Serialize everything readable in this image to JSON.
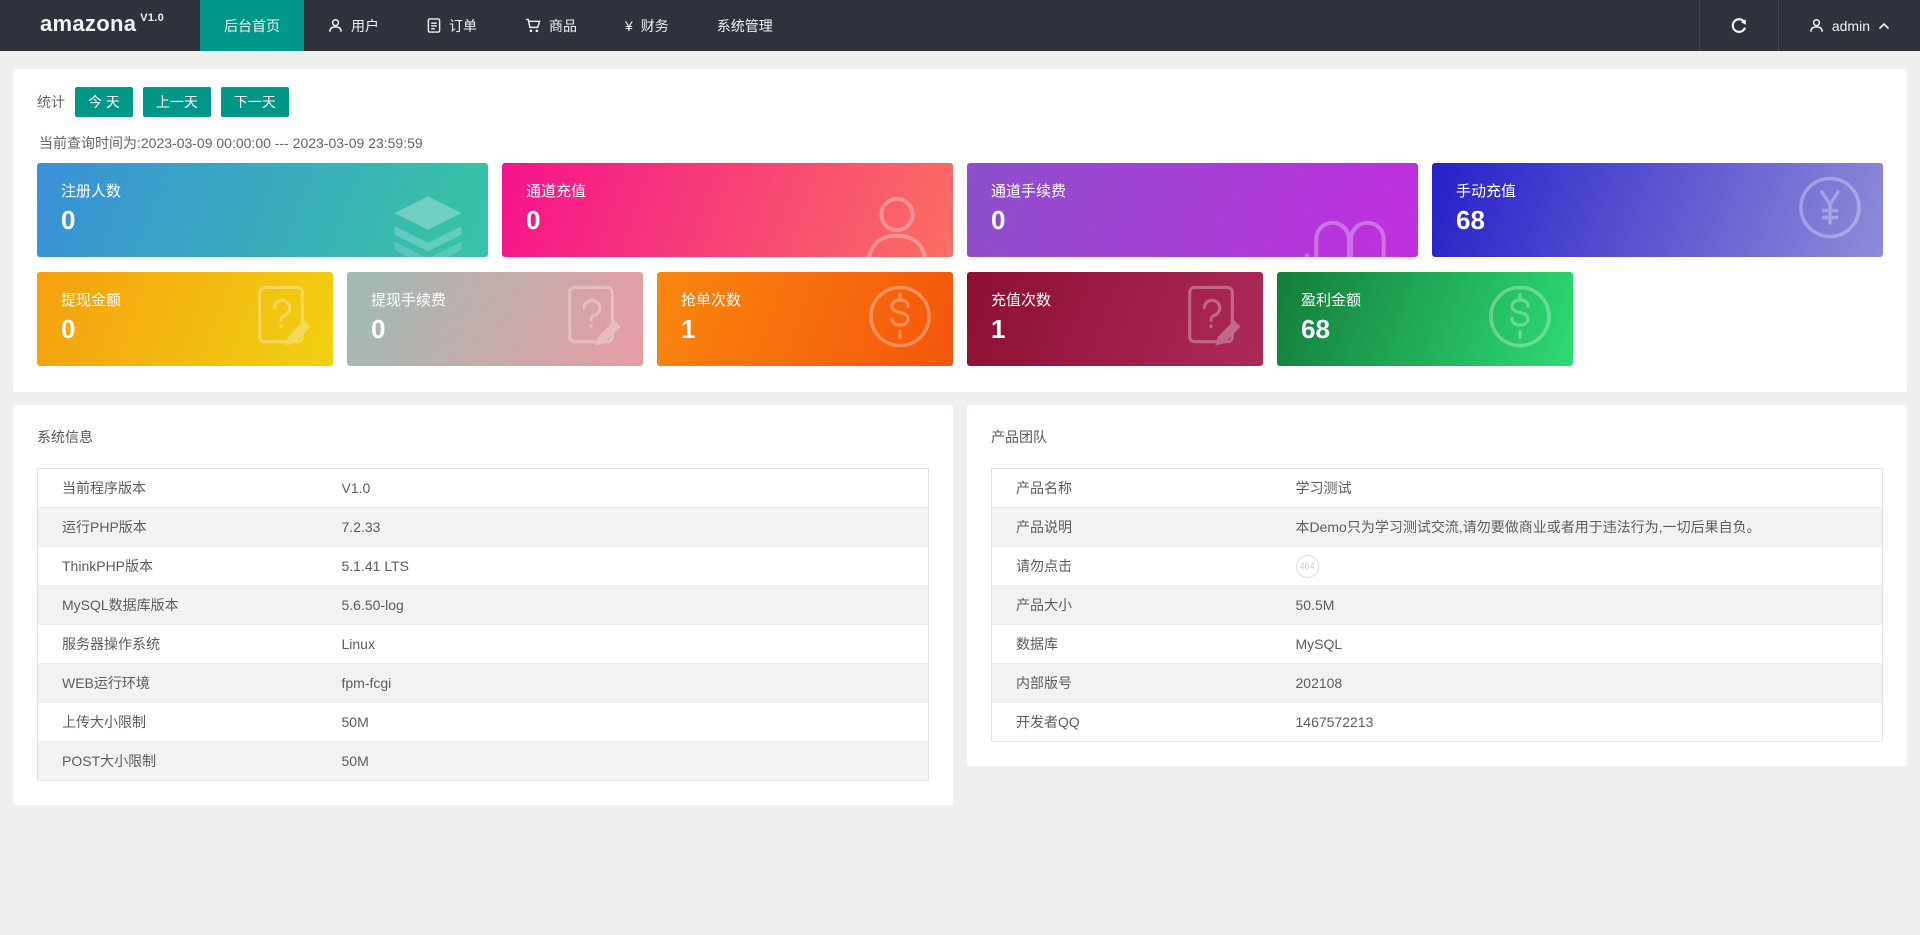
{
  "navbar": {
    "brand": "amazona",
    "version": "V1.0",
    "menu": [
      {
        "label": "后台首页",
        "active": true
      },
      {
        "label": "用户",
        "icon": "user-icon"
      },
      {
        "label": "订单",
        "icon": "order-icon"
      },
      {
        "label": "商品",
        "icon": "cart-icon"
      },
      {
        "label": "财务",
        "icon": "yen-icon",
        "icon_glyph": "¥"
      },
      {
        "label": "系统管理"
      }
    ],
    "user_name": "admin"
  },
  "colors": {
    "accent_teal": "#009688",
    "navbar_bg": "#2e323c",
    "page_bg": "#eef0ee"
  },
  "stats": {
    "label": "统计",
    "buttons": [
      {
        "label": "今 天"
      },
      {
        "label": "上一天"
      },
      {
        "label": "下一天"
      }
    ],
    "query_time": "当前查询时间为:2023-03-09 00:00:00 --- 2023-03-09 23:59:59",
    "cards_row1": [
      {
        "label": "注册人数",
        "value": "0",
        "icon": "layers-icon",
        "gradient_from": "#3b90d8",
        "gradient_to": "#37c5a3"
      },
      {
        "label": "通道充值",
        "value": "0",
        "icon": "person-icon",
        "gradient_from": "#f5128c",
        "gradient_to": "#fa6f62"
      },
      {
        "label": "通道手续费",
        "value": "0",
        "icon": "book-icon",
        "gradient_from": "#8a50ca",
        "gradient_to": "#c22ee0"
      },
      {
        "label": "手动充值",
        "value": "68",
        "icon": "yen-circle-icon",
        "gradient_from": "#2620c8",
        "gradient_to": "#8f8bd9"
      }
    ],
    "cards_row2": [
      {
        "label": "提现金额",
        "value": "0",
        "icon": "question-doc-icon",
        "gradient_from": "#f5a00e",
        "gradient_to": "#f1d013"
      },
      {
        "label": "提现手续费",
        "value": "0",
        "icon": "question-doc-icon",
        "gradient_from": "#9fbbb3",
        "gradient_to": "#e89ca4"
      },
      {
        "label": "抢单次数",
        "value": "1",
        "icon": "dollar-circle-icon",
        "gradient_from": "#f9860f",
        "gradient_to": "#f4550c"
      },
      {
        "label": "充值次数",
        "value": "1",
        "icon": "question-doc-icon",
        "gradient_from": "#8d0f32",
        "gradient_to": "#ac2a5b"
      },
      {
        "label": "盈利金额",
        "value": "68",
        "icon": "dollar-circle-icon",
        "gradient_from": "#147c3b",
        "gradient_to": "#2edb74"
      }
    ]
  },
  "system_info": {
    "title": "系统信息",
    "rows": [
      {
        "label": "当前程序版本",
        "value": "V1.0"
      },
      {
        "label": "运行PHP版本",
        "value": "7.2.33"
      },
      {
        "label": "ThinkPHP版本",
        "value": "5.1.41 LTS"
      },
      {
        "label": "MySQL数据库版本",
        "value": "5.6.50-log"
      },
      {
        "label": "服务器操作系统",
        "value": "Linux"
      },
      {
        "label": "WEB运行环境",
        "value": "fpm-fcgi"
      },
      {
        "label": "上传大小限制",
        "value": "50M"
      },
      {
        "label": "POST大小限制",
        "value": "50M"
      }
    ]
  },
  "product_team": {
    "title": "产品团队",
    "rows": [
      {
        "label": "产品名称",
        "value": "学习测试"
      },
      {
        "label": "产品说明",
        "value": "本Demo只为学习测试交流,请勿要做商业或者用于违法行为,一切后果自负。"
      },
      {
        "label": "请勿点击",
        "value": "",
        "badge": "404"
      },
      {
        "label": "产品大小",
        "value": "50.5M"
      },
      {
        "label": "数据库",
        "value": "MySQL"
      },
      {
        "label": "内部版号",
        "value": "202108"
      },
      {
        "label": "开发者QQ",
        "value": "1467572213"
      }
    ]
  }
}
